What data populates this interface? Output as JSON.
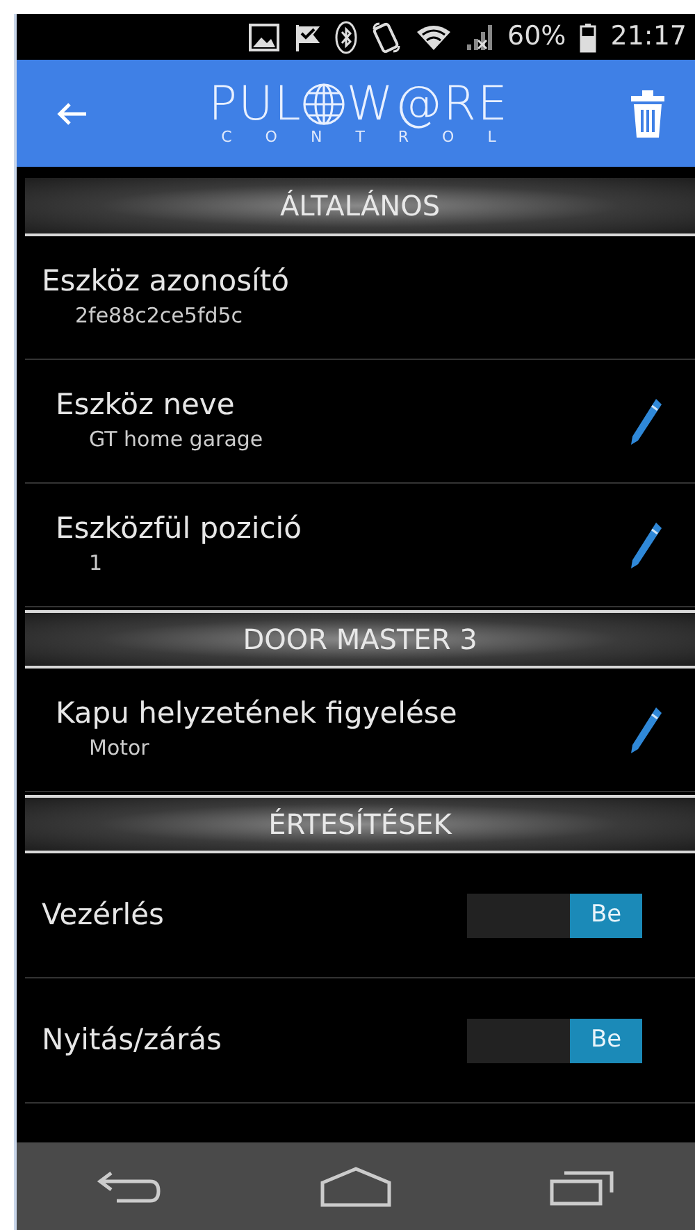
{
  "status_bar": {
    "battery": "60%",
    "time": "21:17"
  },
  "app_bar": {
    "logo": {
      "left": "PUL",
      "right": "W@RE",
      "subtitle": "CONTROL"
    }
  },
  "sections": [
    {
      "title": "ÁLTALÁNOS",
      "items": [
        {
          "kind": "info",
          "label": "Eszköz azonosító",
          "value": "2fe88c2ce5fd5c"
        },
        {
          "kind": "editable",
          "label": "Eszköz neve",
          "value": "GT home garage"
        },
        {
          "kind": "editable",
          "label": "Eszközfül pozició",
          "value": "1"
        }
      ]
    },
    {
      "title": "DOOR MASTER 3",
      "items": [
        {
          "kind": "editable",
          "label": "Kapu helyzetének figyelése",
          "value": "Motor"
        }
      ]
    },
    {
      "title": "ÉRTESÍTÉSEK",
      "items": [
        {
          "kind": "toggle",
          "label": "Vezérlés",
          "on": true,
          "state_label": "Be"
        },
        {
          "kind": "toggle",
          "label": "Nyitás/zárás",
          "on": true,
          "state_label": "Be"
        }
      ]
    }
  ]
}
